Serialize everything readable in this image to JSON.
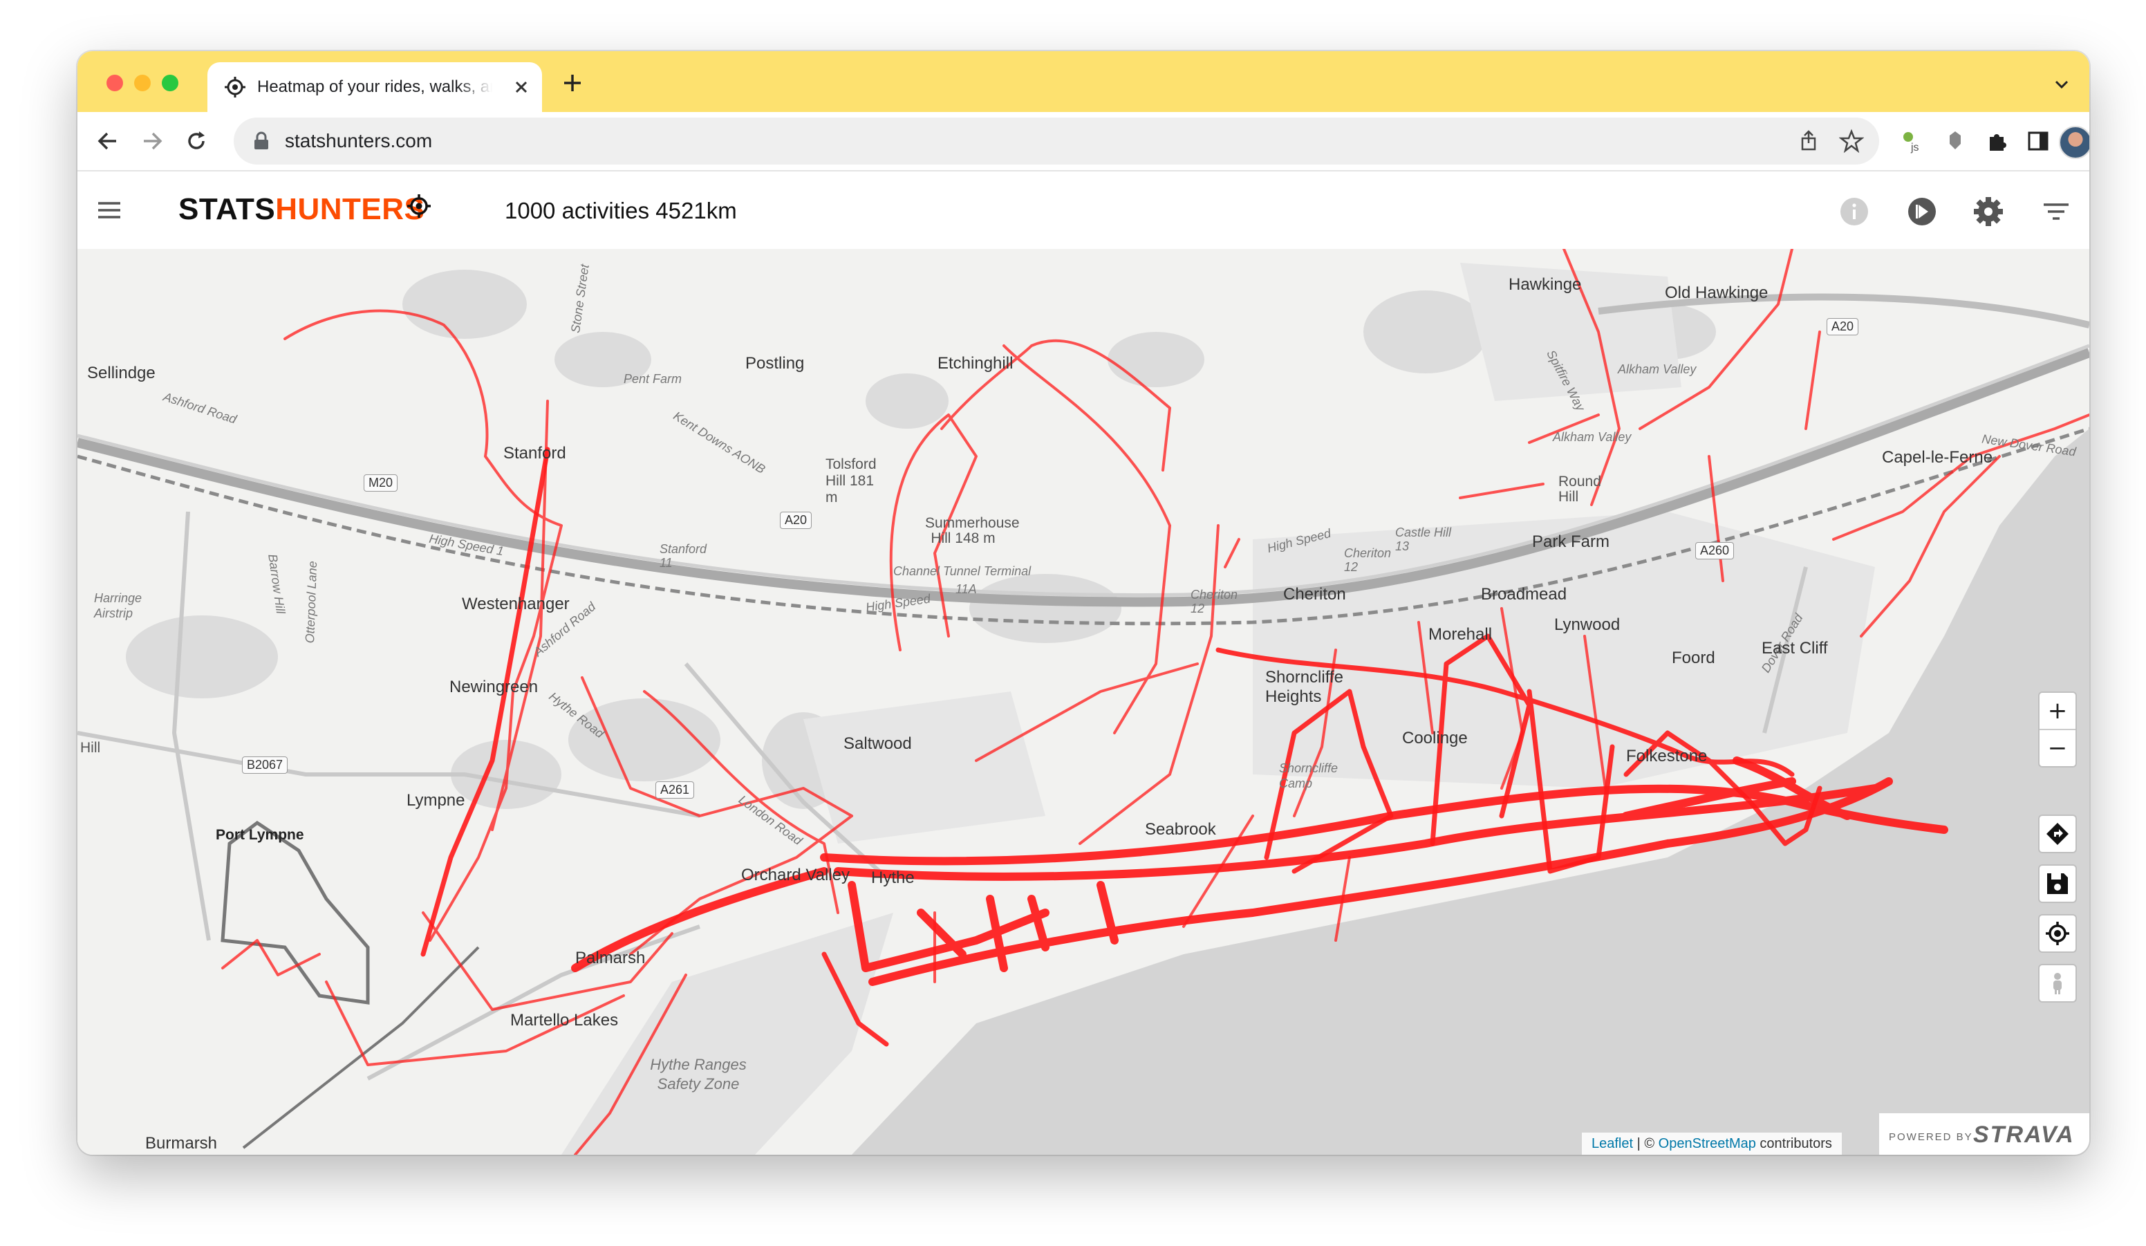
{
  "browser": {
    "tab_title": "Heatmap of your rides, walks, and runs",
    "url": "statshunters.com"
  },
  "app": {
    "logo_part1": "STATS",
    "logo_part2": "HUNTERS",
    "summary": "1000 activities 4521km"
  },
  "map": {
    "labels": {
      "etchinghill": "Etchinghill",
      "hawkinge": "Hawkinge",
      "old_hawkinge": "Old Hawkinge",
      "sellindge": "Sellindge",
      "postling": "Postling",
      "pent_farm": "Pent Farm",
      "stanford": "Stanford",
      "stone_street": "Stone Street",
      "ashford_road": "Ashford Road",
      "kent_downs": "Kent Downs AONB",
      "tolsford": "Tolsford Hill 181 m",
      "alkham_valley": "Alkham Valley",
      "alkham_valley2": "Alkham Valley",
      "spitfire_way": "Spitfire Way",
      "round_hill": "Round Hill",
      "capel": "Capel-le-Ferne",
      "new_dover_road": "New Dover Road",
      "barrow_hill": "Barrow Hill",
      "high_speed1": "High Speed 1",
      "stanford11": "Stanford 11",
      "summerhouse": "Summerhouse Hill 148 m",
      "channel_tunnel": "Channel Tunnel Terminal",
      "eleven_a": "11A",
      "high_speed2": "High Speed",
      "cheriton12": "Cheriton 12",
      "cheriton": "Cheriton",
      "high_speed3": "High Speed",
      "cheriton12b": "Cheriton 12",
      "castle_hill": "Castle Hill 13",
      "park_farm": "Park Farm",
      "broadmead": "Broadmead",
      "lynwood": "Lynwood",
      "morehall": "Morehall",
      "foord": "Foord",
      "dover_road": "Dover Road",
      "east_cliff": "East Cliff",
      "harringe": "Harringe Airstrip",
      "westenhanger": "Westenhanger",
      "ashford_road2": "Ashford Road",
      "newingreen": "Newingreen",
      "hythe_road": "Hythe Road",
      "otterpool": "Otterpool Lane",
      "saltwood": "Saltwood",
      "shorncliffe_heights": "Shorncliffe Heights",
      "shorncliffe_camp": "Shorncliffe Camp",
      "cooling": "Coolinge",
      "folkestone": "Folkestone",
      "hill": "Hill",
      "lympne": "Lympne",
      "port_lympne": "Port Lympne",
      "london_road": "London Road",
      "orchard_valley": "Orchard Valley",
      "hythe": "Hythe",
      "seabrook": "Seabrook",
      "palmarsh": "Palmarsh",
      "martello": "Martello Lakes",
      "hythe_ranges": "Hythe Ranges Safety Zone",
      "burmarsh": "Burmarsh"
    },
    "shields": {
      "m20": "M20",
      "a20_west": "A20",
      "a20_east": "A20",
      "a260": "A260",
      "a261": "A261",
      "b2067": "B2067"
    },
    "attribution_leaflet": "Leaflet",
    "attribution_sep": " | © ",
    "attribution_osm": "OpenStreetMap",
    "attribution_tail": " contributors",
    "zoom_in": "+",
    "zoom_out": "−",
    "powered_by": "POWERED BY",
    "strava": "STRAVA"
  },
  "colors": {
    "tabstrip": "#fde16f",
    "track": "#ff1a1a",
    "brand_orange": "#fc4c02"
  }
}
